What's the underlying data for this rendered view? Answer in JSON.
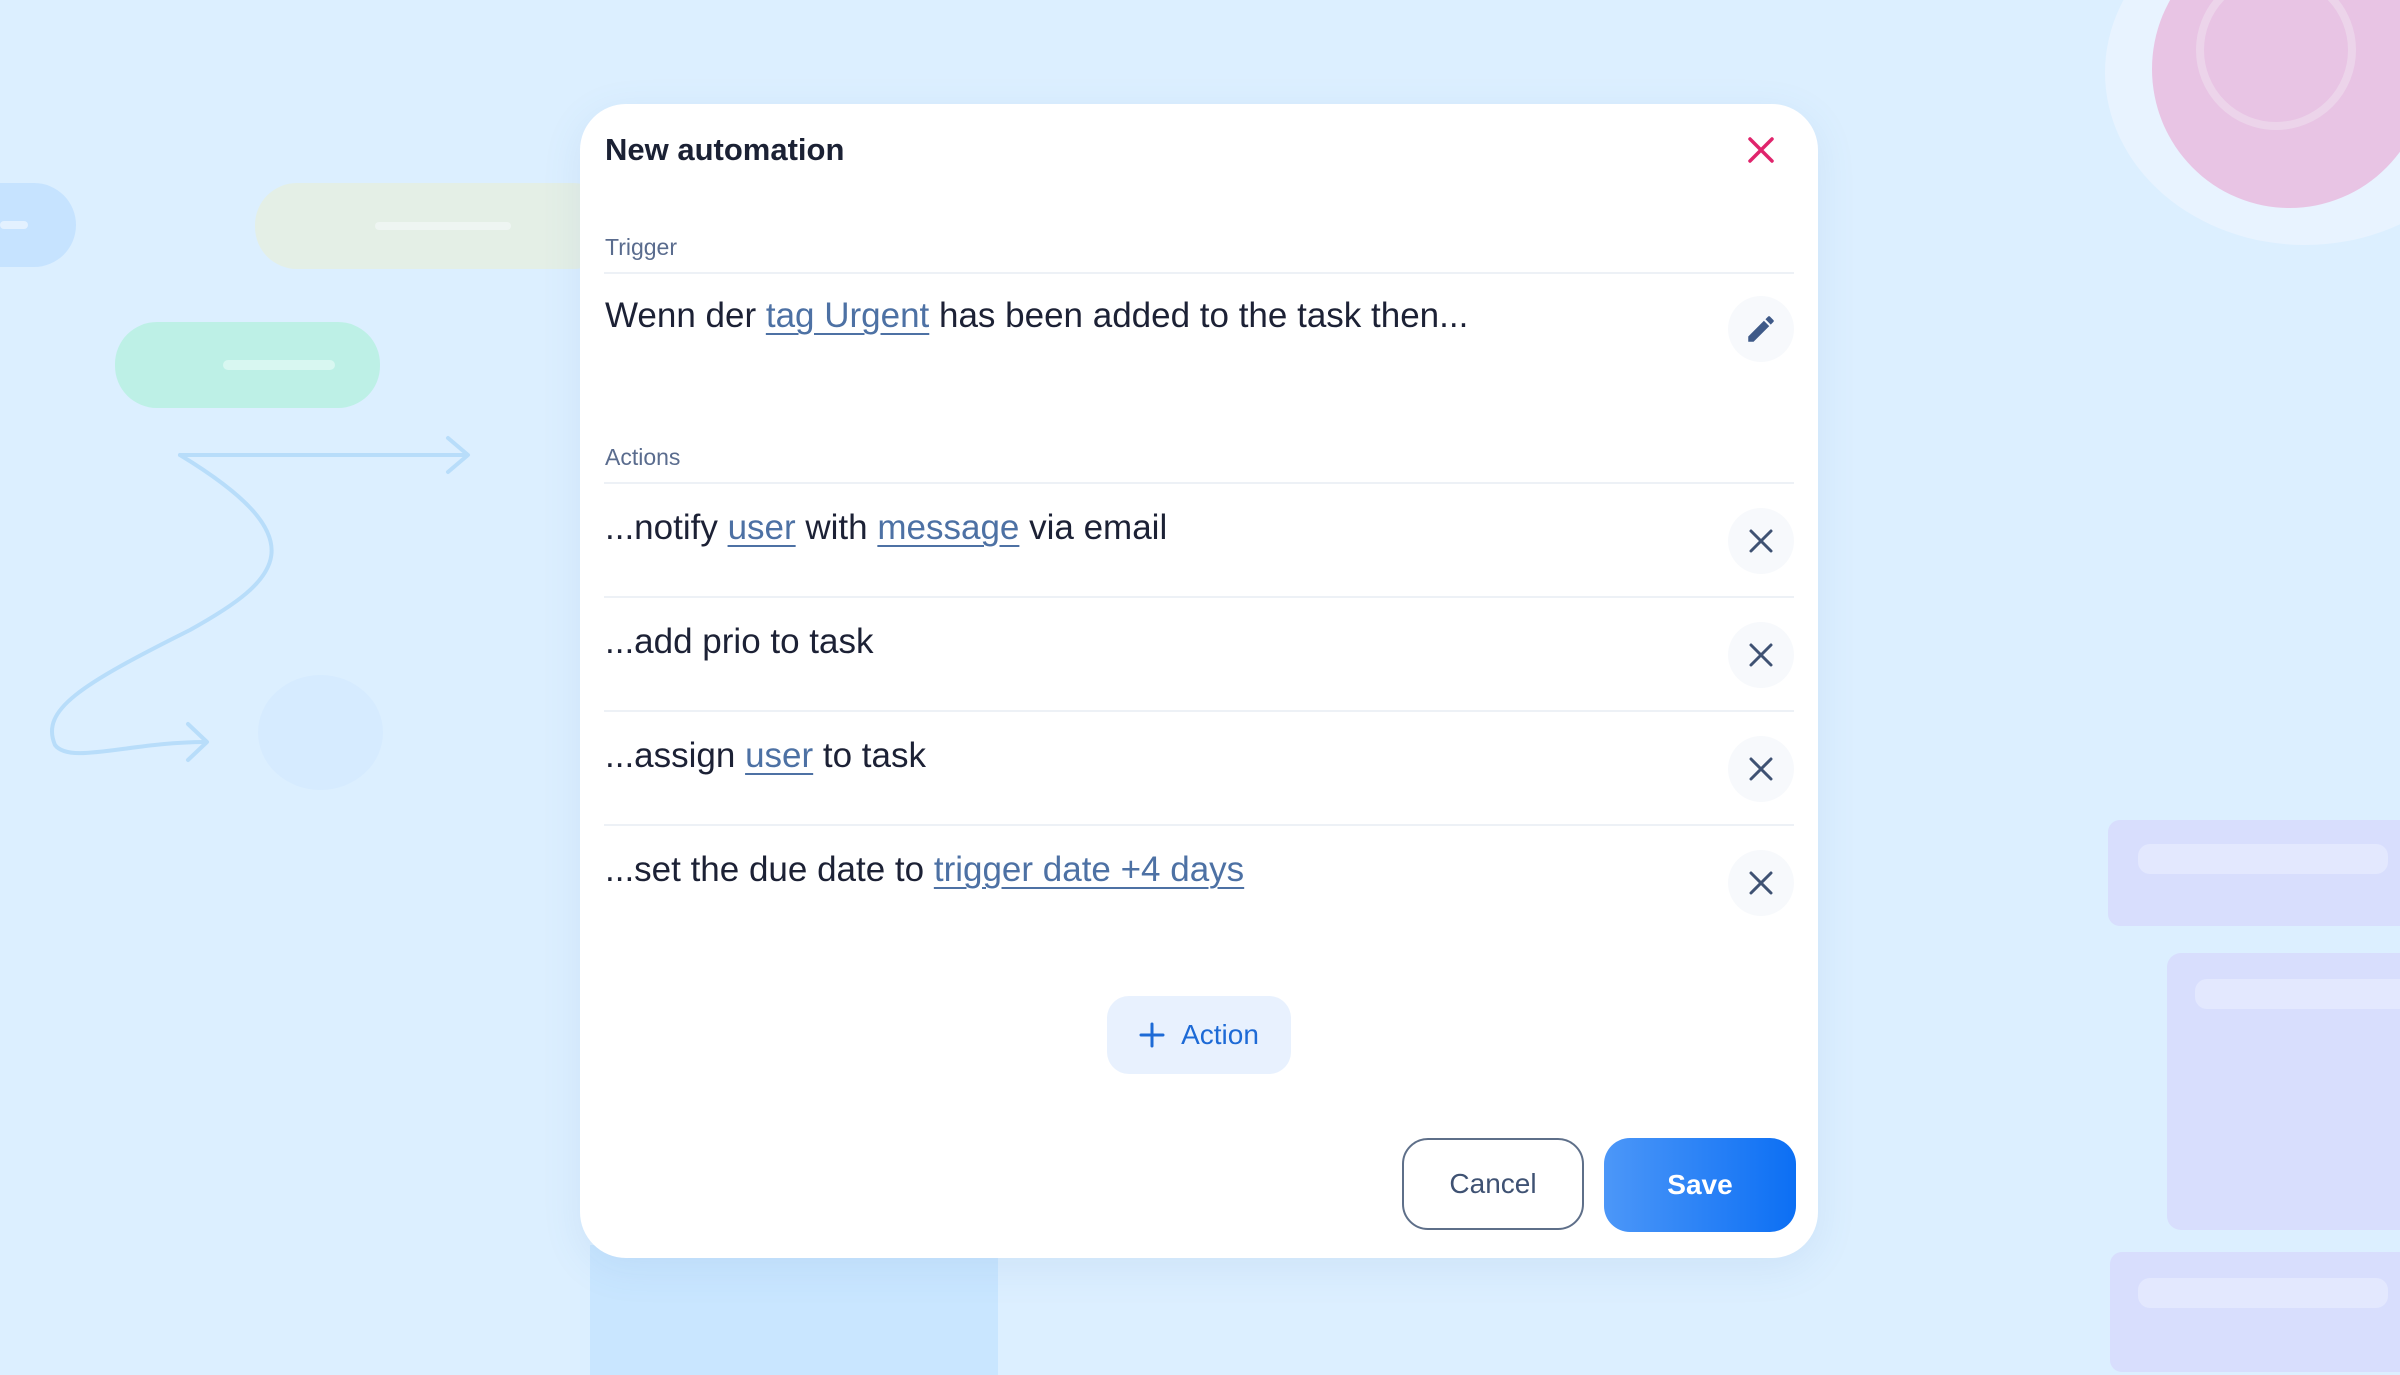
{
  "dialog": {
    "title": "New automation",
    "trigger_label": "Trigger",
    "trigger": {
      "prefix": "Wenn der ",
      "link": "tag Urgent",
      "suffix": " has been added to the task then..."
    },
    "actions_label": "Actions",
    "actions": [
      {
        "p1": "...notify ",
        "l1": "user",
        "p2": " with ",
        "l2": "message",
        "p3": " via email"
      },
      {
        "p1": "...add prio to task"
      },
      {
        "p1": "...assign ",
        "l1": "user",
        "p2": " to task"
      },
      {
        "p1": "...set the due date to ",
        "l1": "trigger date +4 days"
      }
    ],
    "add_action_label": "Action",
    "cancel_label": "Cancel",
    "save_label": "Save"
  },
  "icons": {
    "close": "close-icon",
    "edit": "pencil-icon",
    "remove": "x-icon",
    "add": "plus-icon"
  },
  "colors": {
    "close": "#e0246c",
    "link": "#4d71a4",
    "primary": "#1170f4",
    "background": "#dcefff"
  }
}
